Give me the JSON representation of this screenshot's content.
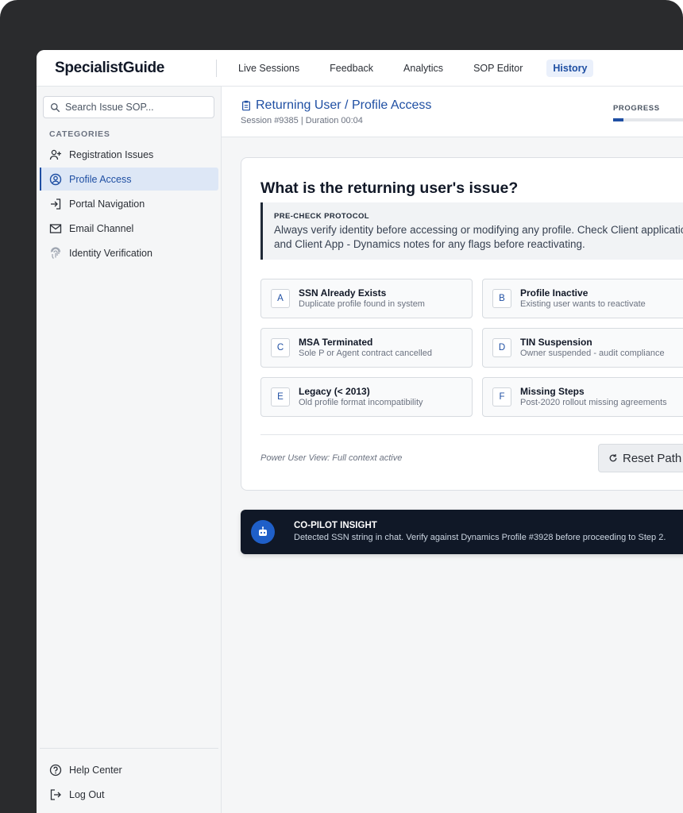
{
  "header": {
    "brand": "SpecialistGuide",
    "nav": [
      "Live Sessions",
      "Feedback",
      "Analytics",
      "SOP Editor",
      "History"
    ],
    "active_nav": "History"
  },
  "sidebar": {
    "search_placeholder": "Search Issue SOP...",
    "categories_label": "CATEGORIES",
    "items": [
      {
        "label": "Registration Issues",
        "icon": "user-plus-icon"
      },
      {
        "label": "Profile Access",
        "icon": "user-circle-icon",
        "active": true
      },
      {
        "label": "Portal Navigation",
        "icon": "login-icon"
      },
      {
        "label": "Email Channel",
        "icon": "mail-icon"
      },
      {
        "label": "Identity Verification",
        "icon": "fingerprint-icon"
      }
    ],
    "bottom": [
      {
        "label": "Help Center",
        "icon": "help-icon"
      },
      {
        "label": "Log Out",
        "icon": "logout-icon"
      }
    ]
  },
  "session": {
    "title": "Returning User / Profile Access",
    "meta": "Session #9385 | Duration 00:04",
    "progress_label": "PROGRESS",
    "progress_fraction": 0.15
  },
  "card": {
    "question": "What is the returning user's issue?",
    "precheck_title": "PRE-CHECK PROTOCOL",
    "precheck_text": "Always verify identity before accessing or modifying any profile. Check Client application and Client App - Dynamics notes for any flags before reactivating.",
    "options": [
      {
        "letter": "A",
        "title": "SSN Already Exists",
        "sub": "Duplicate profile found in system"
      },
      {
        "letter": "B",
        "title": "Profile Inactive",
        "sub": "Existing user wants to reactivate"
      },
      {
        "letter": "C",
        "title": "MSA Terminated",
        "sub": "Sole P or Agent contract cancelled"
      },
      {
        "letter": "D",
        "title": "TIN Suspension",
        "sub": "Owner suspended - audit compliance"
      },
      {
        "letter": "E",
        "title": "Legacy (< 2013)",
        "sub": "Old profile format incompatibility"
      },
      {
        "letter": "F",
        "title": "Missing Steps",
        "sub": "Post-2020 rollout missing agreements"
      }
    ],
    "power_note": "Power User View: Full context active",
    "reset_label": "Reset Path"
  },
  "insight": {
    "title": "CO-PILOT INSIGHT",
    "text": "Detected SSN string in chat. Verify against Dynamics Profile #3928 before proceeding to Step 2."
  },
  "colors": {
    "accent": "#1f4fa3",
    "insight_bg": "#101827",
    "device_frame": "#2a2b2d"
  }
}
